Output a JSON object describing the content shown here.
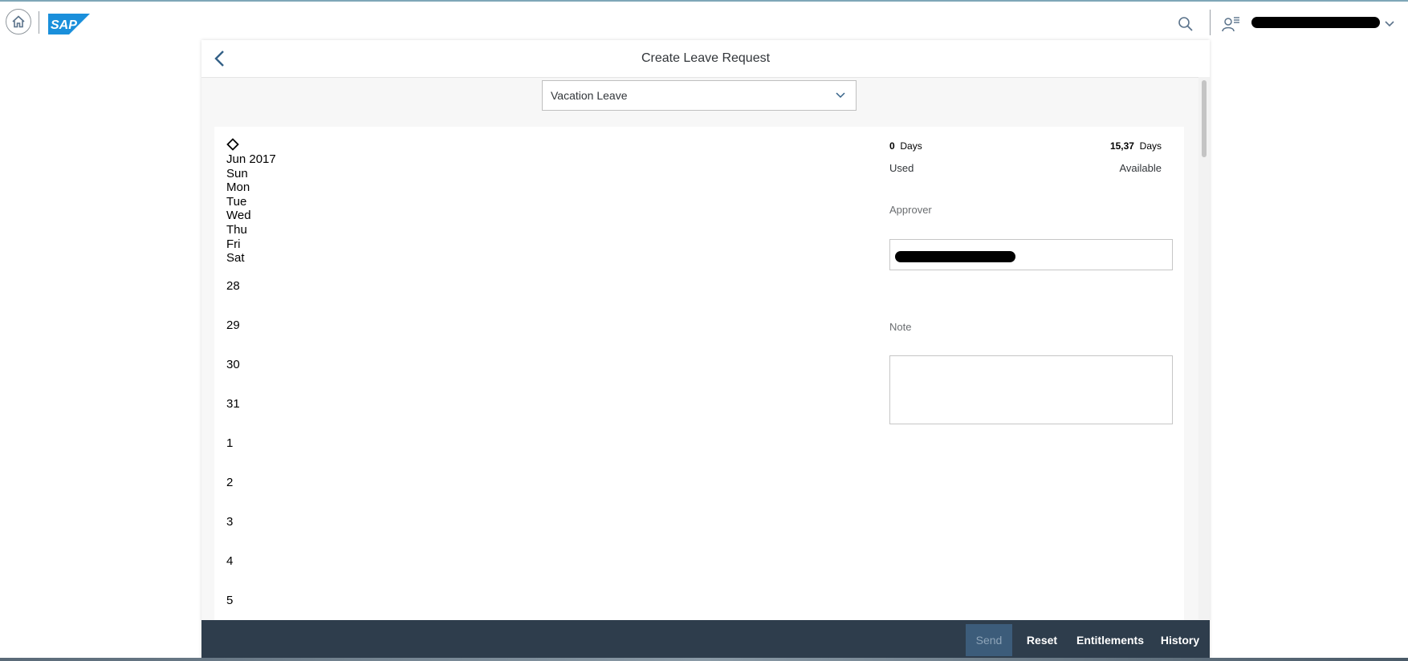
{
  "shell": {
    "logo_text": "SAP"
  },
  "page": {
    "title": "Create Leave Request"
  },
  "leave_type": {
    "selected": "Vacation Leave"
  },
  "calendar": {
    "month": "Jun 2017",
    "weekdays": [
      "Sun",
      "Mon",
      "Tue",
      "Wed",
      "Thu",
      "Fri",
      "Sat"
    ],
    "dates": [
      "28",
      "29",
      "30",
      "31",
      "1",
      "2",
      "3",
      "4",
      "5"
    ]
  },
  "balance": {
    "used_value": "0",
    "used_unit": "Days",
    "used_label": "Used",
    "available_value": "15,37",
    "available_unit": "Days",
    "available_label": "Available"
  },
  "form": {
    "approver_label": "Approver",
    "note_label": "Note"
  },
  "footer": {
    "send": "Send",
    "reset": "Reset",
    "entitlements": "Entitlements",
    "history": "History"
  }
}
